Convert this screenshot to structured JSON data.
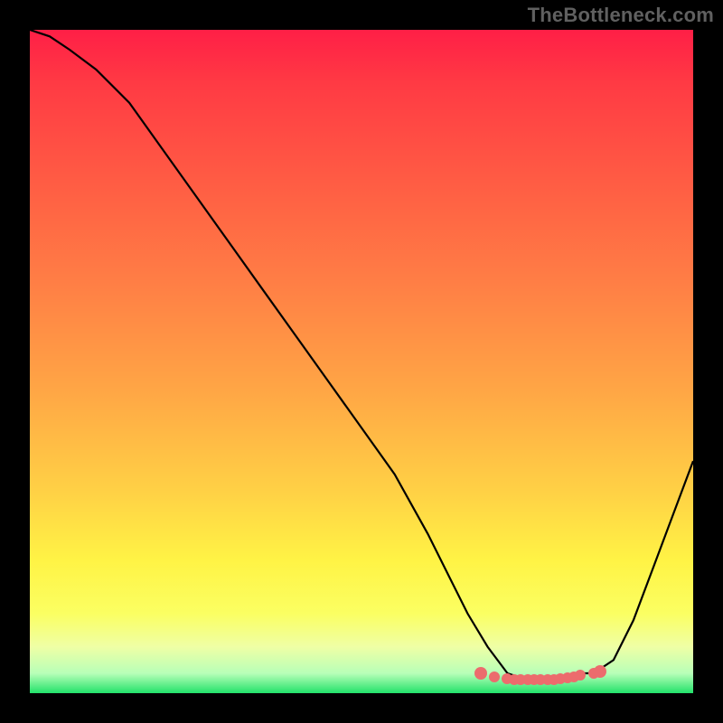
{
  "watermark": "TheBottleneck.com",
  "chart_data": {
    "type": "line",
    "title": "",
    "xlabel": "",
    "ylabel": "",
    "xlim": [
      0,
      100
    ],
    "ylim": [
      0,
      100
    ],
    "series": [
      {
        "name": "bottleneck-curve",
        "x": [
          0,
          3,
          6,
          10,
          15,
          20,
          25,
          30,
          35,
          40,
          45,
          50,
          55,
          60,
          63,
          66,
          69,
          72,
          75,
          78,
          80,
          82,
          85,
          88,
          91,
          94,
          97,
          100
        ],
        "y": [
          100,
          99,
          97,
          94,
          89,
          82,
          75,
          68,
          61,
          54,
          47,
          40,
          33,
          24,
          18,
          12,
          7,
          3,
          2,
          2,
          2,
          3,
          3,
          5,
          11,
          19,
          27,
          35
        ]
      }
    ],
    "markers": {
      "name": "optimal-range",
      "x": [
        68,
        70,
        72,
        73,
        74,
        75,
        76,
        77,
        78,
        79,
        80,
        81,
        82,
        83,
        85,
        86
      ],
      "y": [
        3,
        2.5,
        2.2,
        2.1,
        2.0,
        2.0,
        2.0,
        2.0,
        2.0,
        2.1,
        2.2,
        2.3,
        2.5,
        2.7,
        3.0,
        3.3
      ]
    },
    "colors": {
      "curve": "#000000",
      "marker": "#ec6c6d",
      "gradient_top": "#ff1f46",
      "gradient_bottom": "#22e26a"
    }
  }
}
